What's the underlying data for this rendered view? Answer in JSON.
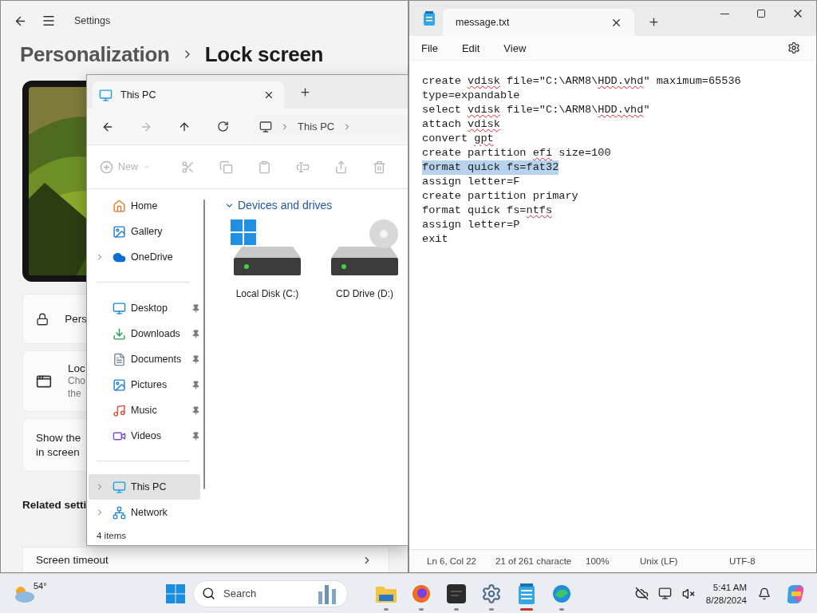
{
  "settings": {
    "title": "Settings",
    "breadcrumb_parent": "Personalization",
    "breadcrumb_current": "Lock screen",
    "cards": [
      {
        "kind": "lock",
        "title": "Pers"
      },
      {
        "kind": "app",
        "title": "Loc",
        "lines": [
          "Cho",
          "the"
        ]
      },
      {
        "kind": "text",
        "lines": [
          "Show the",
          "in screen"
        ]
      }
    ],
    "related_heading": "Related setti",
    "related_items": [
      "Screen timeout"
    ]
  },
  "explorer": {
    "tab": "This PC",
    "path": "This PC",
    "toolbar_new": "New",
    "forward_disabled": true,
    "sidebar": [
      [
        {
          "label": "Home",
          "kind": "home",
          "expandable": false,
          "pinned": false,
          "selected": false
        },
        {
          "label": "Gallery",
          "kind": "gallery",
          "expandable": false,
          "pinned": false,
          "selected": false
        },
        {
          "label": "OneDrive",
          "kind": "cloud",
          "expandable": true,
          "pinned": false,
          "selected": false
        }
      ],
      [
        {
          "label": "Desktop",
          "kind": "desktop",
          "expandable": false,
          "pinned": true,
          "selected": false
        },
        {
          "label": "Downloads",
          "kind": "downloads",
          "expandable": false,
          "pinned": true,
          "selected": false
        },
        {
          "label": "Documents",
          "kind": "documents",
          "expandable": false,
          "pinned": true,
          "selected": false
        },
        {
          "label": "Pictures",
          "kind": "pictures",
          "expandable": false,
          "pinned": true,
          "selected": false
        },
        {
          "label": "Music",
          "kind": "music",
          "expandable": false,
          "pinned": true,
          "selected": false
        },
        {
          "label": "Videos",
          "kind": "videos",
          "expandable": false,
          "pinned": true,
          "selected": false
        }
      ],
      [
        {
          "label": "This PC",
          "kind": "pc",
          "expandable": true,
          "pinned": false,
          "selected": true
        },
        {
          "label": "Network",
          "kind": "network",
          "expandable": true,
          "pinned": false,
          "selected": false
        }
      ]
    ],
    "group": "Devices and drives",
    "expanded": true,
    "drives": [
      {
        "label": "Local Disk (C:)",
        "kind": "system"
      },
      {
        "label": "CD Drive (D:)",
        "kind": "cd"
      }
    ],
    "status": "4 items"
  },
  "notepad": {
    "tab": "message.txt",
    "menu": [
      "File",
      "Edit",
      "View"
    ],
    "lines": [
      {
        "selected": false,
        "segments": [
          {
            "text": "create ",
            "misspelled": false
          },
          {
            "text": "vdisk",
            "misspelled": true
          },
          {
            "text": " file=\"C:\\ARM8\\",
            "misspelled": false
          },
          {
            "text": "HDD.vhd",
            "misspelled": true
          },
          {
            "text": "\" maximum=65536",
            "misspelled": false
          }
        ]
      },
      {
        "selected": false,
        "segments": [
          {
            "text": "type=expandable",
            "misspelled": false
          }
        ]
      },
      {
        "selected": false,
        "segments": [
          {
            "text": "select ",
            "misspelled": false
          },
          {
            "text": "vdisk",
            "misspelled": true
          },
          {
            "text": " file=\"C:\\ARM8\\",
            "misspelled": false
          },
          {
            "text": "HDD.vhd",
            "misspelled": true
          },
          {
            "text": "\"",
            "misspelled": false
          }
        ]
      },
      {
        "selected": false,
        "segments": [
          {
            "text": "attach ",
            "misspelled": false
          },
          {
            "text": "vdisk",
            "misspelled": true
          }
        ]
      },
      {
        "selected": false,
        "segments": [
          {
            "text": "convert ",
            "misspelled": false
          },
          {
            "text": "gpt",
            "misspelled": true
          }
        ]
      },
      {
        "selected": false,
        "segments": [
          {
            "text": "create partition ",
            "misspelled": false
          },
          {
            "text": "efi",
            "misspelled": true
          },
          {
            "text": " size=100",
            "misspelled": false
          }
        ]
      },
      {
        "selected": true,
        "segments": [
          {
            "text": "format quick fs=fat32",
            "misspelled": false
          }
        ]
      },
      {
        "selected": false,
        "segments": [
          {
            "text": "assign letter=F",
            "misspelled": false
          }
        ]
      },
      {
        "selected": false,
        "segments": [
          {
            "text": "create partition primary",
            "misspelled": false
          }
        ]
      },
      {
        "selected": false,
        "segments": [
          {
            "text": "format quick fs=",
            "misspelled": false
          },
          {
            "text": "ntfs",
            "misspelled": true
          }
        ]
      },
      {
        "selected": false,
        "segments": [
          {
            "text": "assign letter=P",
            "misspelled": false
          }
        ]
      },
      {
        "selected": false,
        "segments": [
          {
            "text": "exit",
            "misspelled": false
          }
        ]
      }
    ],
    "status": [
      "Ln 6, Col 22",
      "21 of 261 characte",
      "100%",
      "Unix (LF)",
      "UTF-8"
    ]
  },
  "taskbar": {
    "weather": "54°",
    "search_placeholder": "Search",
    "apps": [
      {
        "kind": "explorer",
        "active": false
      },
      {
        "kind": "firefox",
        "active": false
      },
      {
        "kind": "terminal",
        "active": false
      },
      {
        "kind": "settings",
        "active": false
      },
      {
        "kind": "notepad",
        "active": true
      },
      {
        "kind": "edge",
        "active": false
      }
    ],
    "time": "5:41 AM",
    "date": "8/28/2024"
  }
}
